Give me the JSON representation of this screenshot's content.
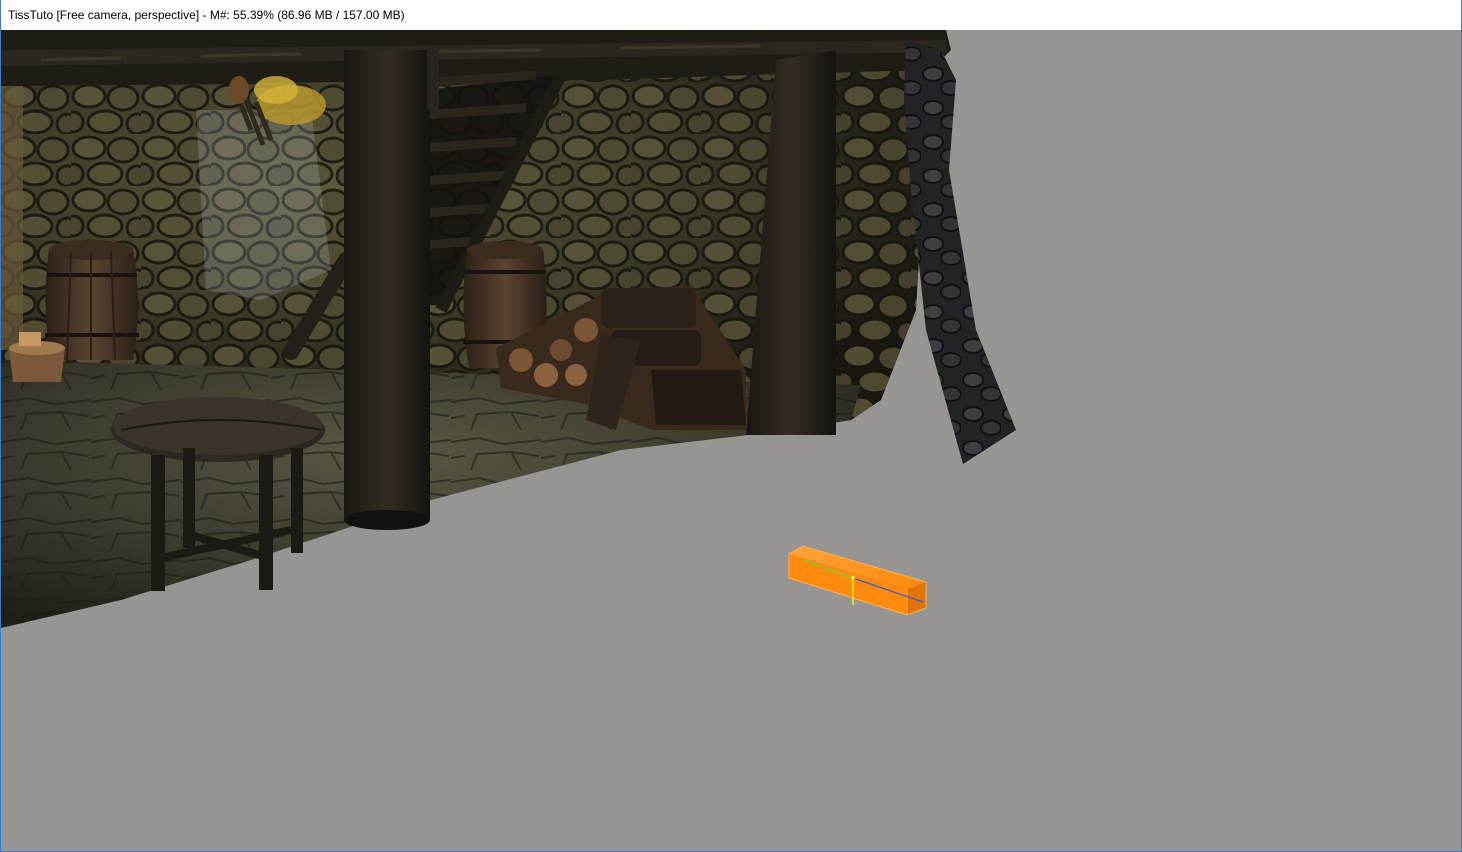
{
  "window": {
    "title": "TissTuto [Free camera, perspective] - M#: 55.39% (86.96 MB / 157.00 MB)"
  },
  "viewport": {
    "background_color": "#969592",
    "selection_color": "#ff8a0e",
    "objects": [
      "stone-wall",
      "wooden-ceiling-beam",
      "wooden-pillar",
      "staircase",
      "wooden-barrel",
      "wooden-bucket",
      "firewood-stack",
      "round-wooden-table",
      "hanging-herbs",
      "curtain-drape",
      "selected-orange-box",
      "transform-gizmo"
    ]
  }
}
